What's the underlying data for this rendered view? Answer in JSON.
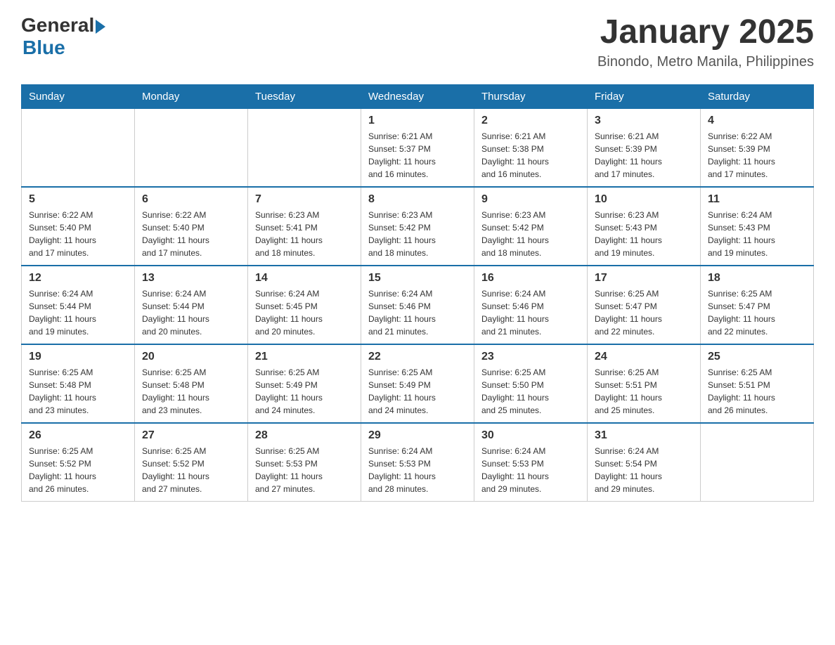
{
  "header": {
    "logo_general": "General",
    "logo_blue": "Blue",
    "month_title": "January 2025",
    "location": "Binondo, Metro Manila, Philippines"
  },
  "weekdays": [
    "Sunday",
    "Monday",
    "Tuesday",
    "Wednesday",
    "Thursday",
    "Friday",
    "Saturday"
  ],
  "weeks": [
    [
      {
        "day": "",
        "info": ""
      },
      {
        "day": "",
        "info": ""
      },
      {
        "day": "",
        "info": ""
      },
      {
        "day": "1",
        "info": "Sunrise: 6:21 AM\nSunset: 5:37 PM\nDaylight: 11 hours\nand 16 minutes."
      },
      {
        "day": "2",
        "info": "Sunrise: 6:21 AM\nSunset: 5:38 PM\nDaylight: 11 hours\nand 16 minutes."
      },
      {
        "day": "3",
        "info": "Sunrise: 6:21 AM\nSunset: 5:39 PM\nDaylight: 11 hours\nand 17 minutes."
      },
      {
        "day": "4",
        "info": "Sunrise: 6:22 AM\nSunset: 5:39 PM\nDaylight: 11 hours\nand 17 minutes."
      }
    ],
    [
      {
        "day": "5",
        "info": "Sunrise: 6:22 AM\nSunset: 5:40 PM\nDaylight: 11 hours\nand 17 minutes."
      },
      {
        "day": "6",
        "info": "Sunrise: 6:22 AM\nSunset: 5:40 PM\nDaylight: 11 hours\nand 17 minutes."
      },
      {
        "day": "7",
        "info": "Sunrise: 6:23 AM\nSunset: 5:41 PM\nDaylight: 11 hours\nand 18 minutes."
      },
      {
        "day": "8",
        "info": "Sunrise: 6:23 AM\nSunset: 5:42 PM\nDaylight: 11 hours\nand 18 minutes."
      },
      {
        "day": "9",
        "info": "Sunrise: 6:23 AM\nSunset: 5:42 PM\nDaylight: 11 hours\nand 18 minutes."
      },
      {
        "day": "10",
        "info": "Sunrise: 6:23 AM\nSunset: 5:43 PM\nDaylight: 11 hours\nand 19 minutes."
      },
      {
        "day": "11",
        "info": "Sunrise: 6:24 AM\nSunset: 5:43 PM\nDaylight: 11 hours\nand 19 minutes."
      }
    ],
    [
      {
        "day": "12",
        "info": "Sunrise: 6:24 AM\nSunset: 5:44 PM\nDaylight: 11 hours\nand 19 minutes."
      },
      {
        "day": "13",
        "info": "Sunrise: 6:24 AM\nSunset: 5:44 PM\nDaylight: 11 hours\nand 20 minutes."
      },
      {
        "day": "14",
        "info": "Sunrise: 6:24 AM\nSunset: 5:45 PM\nDaylight: 11 hours\nand 20 minutes."
      },
      {
        "day": "15",
        "info": "Sunrise: 6:24 AM\nSunset: 5:46 PM\nDaylight: 11 hours\nand 21 minutes."
      },
      {
        "day": "16",
        "info": "Sunrise: 6:24 AM\nSunset: 5:46 PM\nDaylight: 11 hours\nand 21 minutes."
      },
      {
        "day": "17",
        "info": "Sunrise: 6:25 AM\nSunset: 5:47 PM\nDaylight: 11 hours\nand 22 minutes."
      },
      {
        "day": "18",
        "info": "Sunrise: 6:25 AM\nSunset: 5:47 PM\nDaylight: 11 hours\nand 22 minutes."
      }
    ],
    [
      {
        "day": "19",
        "info": "Sunrise: 6:25 AM\nSunset: 5:48 PM\nDaylight: 11 hours\nand 23 minutes."
      },
      {
        "day": "20",
        "info": "Sunrise: 6:25 AM\nSunset: 5:48 PM\nDaylight: 11 hours\nand 23 minutes."
      },
      {
        "day": "21",
        "info": "Sunrise: 6:25 AM\nSunset: 5:49 PM\nDaylight: 11 hours\nand 24 minutes."
      },
      {
        "day": "22",
        "info": "Sunrise: 6:25 AM\nSunset: 5:49 PM\nDaylight: 11 hours\nand 24 minutes."
      },
      {
        "day": "23",
        "info": "Sunrise: 6:25 AM\nSunset: 5:50 PM\nDaylight: 11 hours\nand 25 minutes."
      },
      {
        "day": "24",
        "info": "Sunrise: 6:25 AM\nSunset: 5:51 PM\nDaylight: 11 hours\nand 25 minutes."
      },
      {
        "day": "25",
        "info": "Sunrise: 6:25 AM\nSunset: 5:51 PM\nDaylight: 11 hours\nand 26 minutes."
      }
    ],
    [
      {
        "day": "26",
        "info": "Sunrise: 6:25 AM\nSunset: 5:52 PM\nDaylight: 11 hours\nand 26 minutes."
      },
      {
        "day": "27",
        "info": "Sunrise: 6:25 AM\nSunset: 5:52 PM\nDaylight: 11 hours\nand 27 minutes."
      },
      {
        "day": "28",
        "info": "Sunrise: 6:25 AM\nSunset: 5:53 PM\nDaylight: 11 hours\nand 27 minutes."
      },
      {
        "day": "29",
        "info": "Sunrise: 6:24 AM\nSunset: 5:53 PM\nDaylight: 11 hours\nand 28 minutes."
      },
      {
        "day": "30",
        "info": "Sunrise: 6:24 AM\nSunset: 5:53 PM\nDaylight: 11 hours\nand 29 minutes."
      },
      {
        "day": "31",
        "info": "Sunrise: 6:24 AM\nSunset: 5:54 PM\nDaylight: 11 hours\nand 29 minutes."
      },
      {
        "day": "",
        "info": ""
      }
    ]
  ]
}
